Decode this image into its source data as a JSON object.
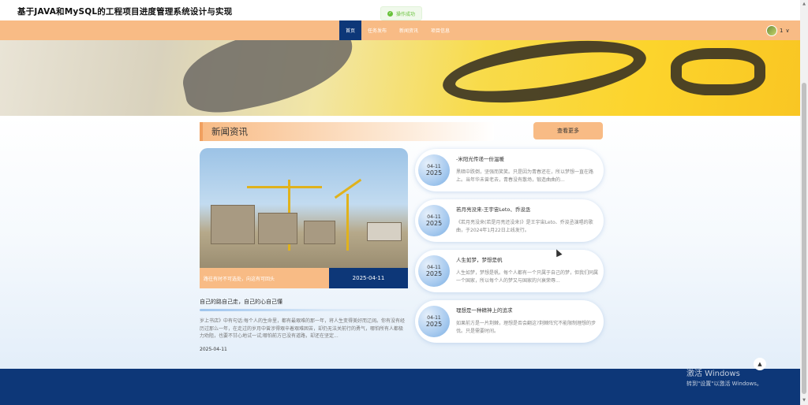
{
  "site": {
    "title": "基于JAVA和MySQL的工程项目进度管理系统设计与实现"
  },
  "toast": {
    "text": "操作成功",
    "icon": "check-circle-icon",
    "color": "#67c23a"
  },
  "nav": {
    "items": [
      {
        "label": "首页",
        "active": true
      },
      {
        "label": "任务发布"
      },
      {
        "label": "新闻资讯"
      },
      {
        "label": "项目信息"
      }
    ],
    "user_label": "1",
    "user_caret": "∨",
    "bg_color": "#f8bb85",
    "active_color": "#0d3778"
  },
  "section": {
    "title": "新闻资讯",
    "more_label": "查看更多"
  },
  "featured": {
    "caption": "路往有时不可选处，向这有可回头",
    "date": "2025-04-11",
    "title": "自己的路自己走，自己的心自己懂",
    "text": "岁上书店》中有句话:每个人的生命里，都有最艰难的那一年，将人生变得美好而辽阔。你有没有经历过那么一年，在走过的岁月中曾涉得艰辛着艰难困苦，却仍无法关前行的勇气，哪怕所有人都极力劝阻，也要不甘心地试一试;哪怕前方已没有道路，却还在坚定...",
    "date_footer": "2025-04-11"
  },
  "news": [
    {
      "month_day": "04-11",
      "year": "2025",
      "title": "-米阳光传递一份温暖",
      "text": "黑暗中跌倒，坚强而笑笑。只是因为青春还在，所以梦想一直在路上。当年华未曾老去，青春没有散场，锻造曲曲的..."
    },
    {
      "month_day": "04-11",
      "year": "2025",
      "title": "若月亮没来-王宇宙Leto、乔浚丞",
      "text": "《若月亮没来(若是月亮还没来)》是王宇宙Leto、乔浚丞演唱的歌曲，于2024年1月22日上线发行。"
    },
    {
      "month_day": "04-11",
      "year": "2025",
      "title": "人生如梦，梦想是帆",
      "text": "人生如梦，梦想是帆。每个人都有一个只属于自己的梦，但我们同属一个国家，所以每个人的梦又与国家的兴衰荣辱..."
    },
    {
      "month_day": "04-11",
      "year": "2025",
      "title": "理想是一种精神上的追求",
      "text": "如果前方是一片荆棘，理想是否会翻这?荆棘阵究不能限制理想的步伐。只是需要时间。"
    }
  ],
  "footer": {
    "back_to_top": "▲",
    "bg_color": "#0d3778"
  },
  "watermark": {
    "title": "激活 Windows",
    "subtitle": "转到\"设置\"以激活 Windows。"
  }
}
